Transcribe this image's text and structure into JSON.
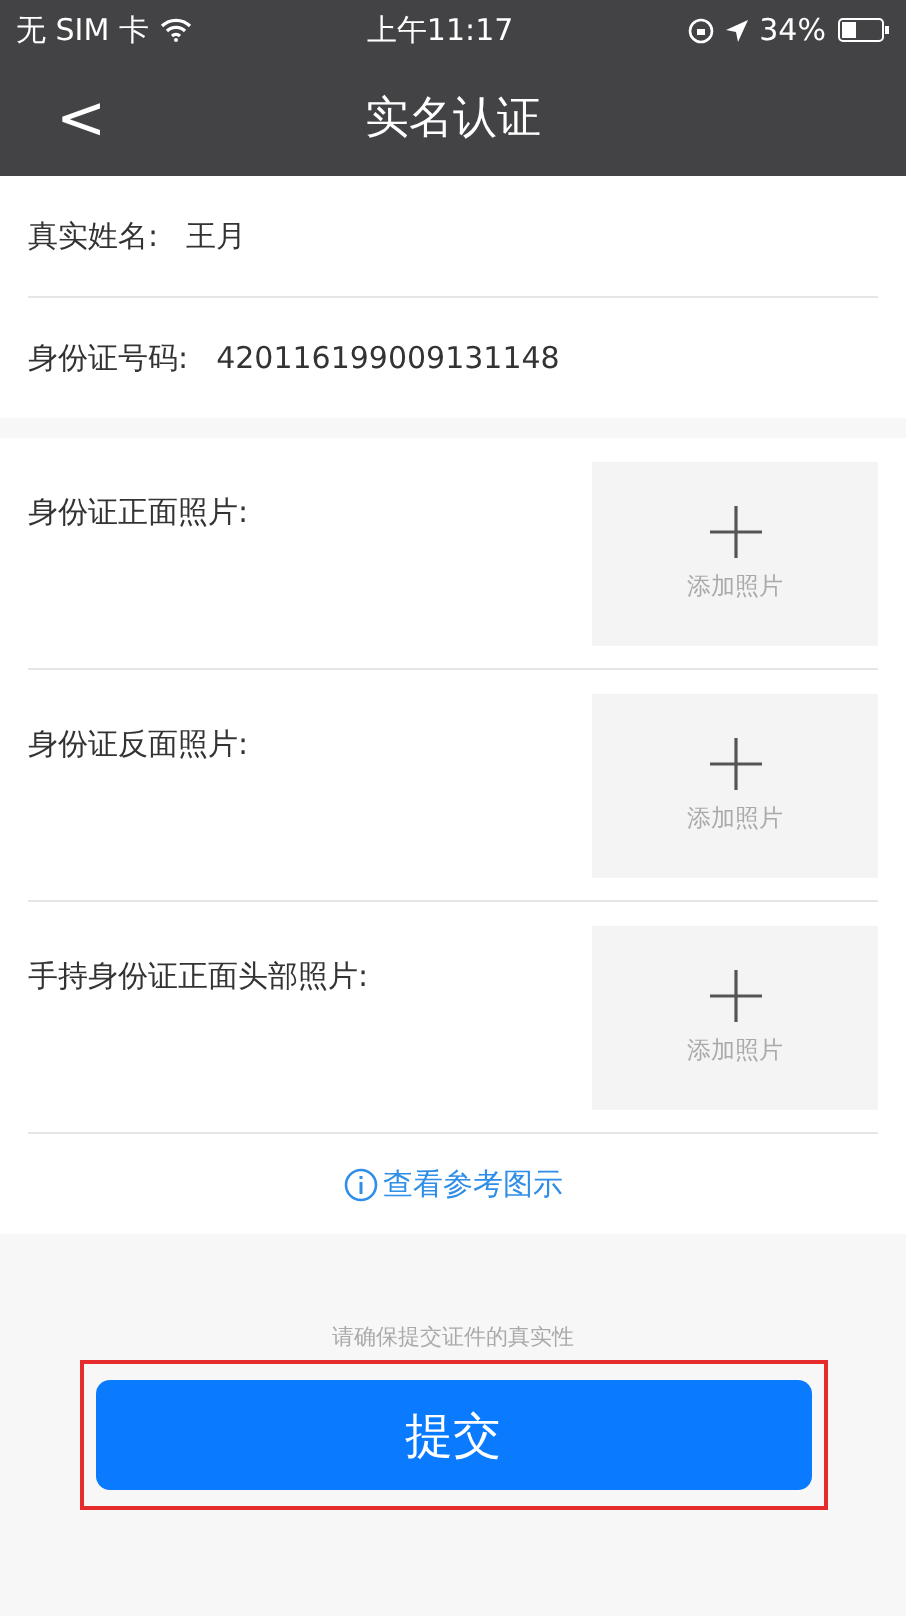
{
  "status_bar": {
    "carrier": "无 SIM 卡",
    "time": "上午11:17",
    "battery": "34%"
  },
  "nav": {
    "back": "<",
    "title": "实名认证"
  },
  "fields": [
    {
      "label": "真实姓名:",
      "value": "王月"
    },
    {
      "label": "身份证号码:",
      "value": "420116199009131148"
    }
  ],
  "photos": [
    {
      "label": "身份证正面照片:",
      "button": "添加照片"
    },
    {
      "label": "身份证反面照片:",
      "button": "添加照片"
    },
    {
      "label": "手持身份证正面头部照片:",
      "button": "添加照片"
    }
  ],
  "reference_link": "查看参考图示",
  "hint": "请确保提交证件的真实性",
  "submit": {
    "label": "提交",
    "highlighted": true
  }
}
